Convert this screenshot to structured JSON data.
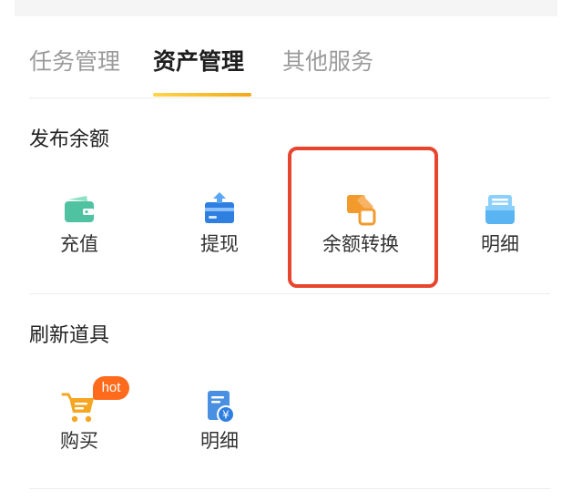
{
  "tabs": [
    {
      "label": "任务管理",
      "active": false
    },
    {
      "label": "资产管理",
      "active": true
    },
    {
      "label": "其他服务",
      "active": false
    }
  ],
  "sections": [
    {
      "title": "发布余额",
      "items": [
        {
          "label": "充值",
          "icon": "wallet-icon"
        },
        {
          "label": "提现",
          "icon": "withdraw-icon"
        },
        {
          "label": "余额转换",
          "icon": "balance-convert-icon",
          "highlighted": true
        },
        {
          "label": "明细",
          "icon": "details-icon"
        }
      ]
    },
    {
      "title": "刷新道具",
      "items": [
        {
          "label": "购买",
          "icon": "shopping-cart-icon",
          "badge": "hot"
        },
        {
          "label": "明细",
          "icon": "receipt-icon"
        }
      ]
    }
  ],
  "colors": {
    "accent_gradient_start": "#ffd54a",
    "accent_gradient_end": "#f2a81a",
    "highlight_border": "#e8452e",
    "badge": "#ff6b1c",
    "wallet_green": "#4fc3a1",
    "withdraw_blue": "#2f7fe0",
    "convert_orange": "#f39a2c",
    "details_blue": "#5ab4f2",
    "cart_orange": "#f5a623",
    "receipt_blue": "#4a90e2"
  }
}
